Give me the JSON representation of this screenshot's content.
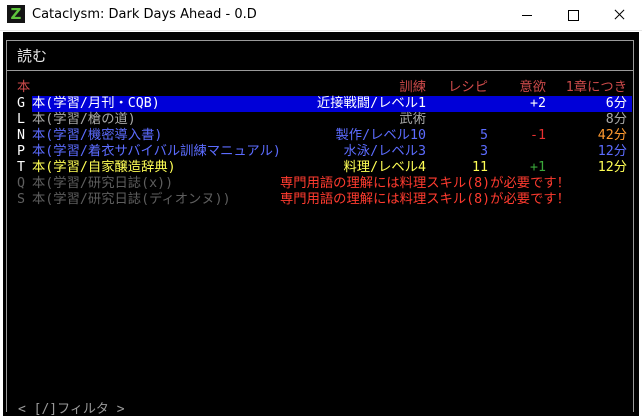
{
  "window": {
    "title": "Cataclysm: Dark Days Ahead - 0.D",
    "icon_glyph": "Z",
    "minimize_label": "—",
    "maximize_label": "☐",
    "close_label": "✕"
  },
  "menu": {
    "title": "読む",
    "filter_hint": "< [/]フィルタ >",
    "headers": {
      "book": "本",
      "skill": "訓練",
      "recipes": "レシピ",
      "fun": "意欲",
      "time": "1章につき"
    },
    "rows": [
      {
        "key": "G",
        "name": "本(学習/月刊・CQB)",
        "skill": "近接戦闘/レベル1",
        "recipes": "",
        "fun": "+2",
        "time": "6分",
        "selected": true
      },
      {
        "key": "L",
        "name": "本(学習/槍の道)",
        "skill": "武術",
        "recipes": "",
        "fun": "",
        "time": "8分"
      },
      {
        "key": "N",
        "name": "本(学習/機密導入書)",
        "skill": "製作/レベル10",
        "recipes": "5",
        "fun": "-1",
        "time": "42分"
      },
      {
        "key": "P",
        "name": "本(学習/着衣サバイバル訓練マニュアル)",
        "skill": "水泳/レベル3",
        "recipes": "3",
        "fun": "",
        "time": "12分"
      },
      {
        "key": "T",
        "name": "本(学習/自家醸造辞典)",
        "skill": "料理/レベル4",
        "recipes": "11",
        "fun": "+1",
        "time": "12分"
      },
      {
        "key": "Q",
        "name": "本(学習/研究日誌(x))",
        "requirement": "専門用語の理解には料理スキル(8)が必要です！"
      },
      {
        "key": "S",
        "name": "本(学習/研究日誌(ディオンヌ))",
        "requirement": "専門用語の理解には料理スキル(8)が必要です！"
      }
    ]
  },
  "colors": {
    "header": "#cc4a4a",
    "selected_bg": "#0000d8",
    "row_selected": "#ffffff",
    "row_grey": "#a8a8a8",
    "row_blue": "#5c6cff",
    "row_yellow": "#ffff55",
    "row_disabled": "#5e5e5e",
    "fun_negative": "#e83030",
    "fun_positive": "#3aa83a",
    "time_orange": "#ff9a30",
    "requirement": "#ff3b2f"
  }
}
